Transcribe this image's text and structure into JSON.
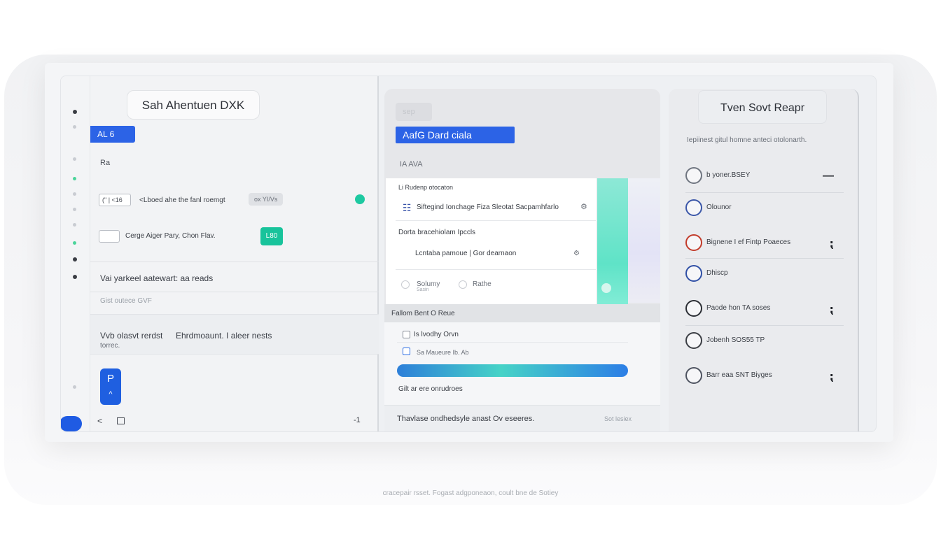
{
  "panel_left": {
    "title": "Sah Ahentuen DXK",
    "tag": "AL 6",
    "small_label": "Ra",
    "row1": {
      "chip": "(\" | <16",
      "text": "<Lboed ahe the fanl roemgt",
      "pill": "ox YI/Vs"
    },
    "row2": {
      "chip": "",
      "text": "Cerge Aiger Pary, Chon Flav.",
      "button": "L80"
    },
    "section1_title": "Vai yarkeel aatewart: aa reads",
    "section1_sub": "Gist outece GVF",
    "section2_left": "Vvb olasvt rerdst",
    "section2_right": "Ehrdmoaunt. I aleer nests",
    "section2_sub": "torrec.",
    "blue_button_icon": "P",
    "blue_button_caret": "^",
    "back_icon": "<",
    "page_counter": "-1"
  },
  "panel_middle": {
    "faint_tab": "sep",
    "tag": "AafG Dard ciala",
    "label": "IA AVA",
    "card_header": "Li Rudenp otocaton",
    "item1": "Siftegind Ionchage Fiza  Sleotat  Sacpamhfarlo",
    "item2": "Dorta bracehiolam Ipccls",
    "item3": "Lcntaba pamoue | Gor dearnaon",
    "item4_left": "Solumy",
    "item4_left_sub": "Sasin",
    "item4_right": "Rathe",
    "strip": "Fallom  Bent O Reue",
    "check1": "Is lvodhy Orvn",
    "check2": "Sa Maueure Ib. Ab",
    "lower_text": "Gilt ar ere onrudroes",
    "bottom_left": "Thavlase ondhedsyle anast  Ov eseeres.",
    "bottom_right": "Sot lesiex"
  },
  "panel_right": {
    "title": "Tven Sovt Reapr",
    "description": "Iepiinest gitul homne anteci  otolonarth.",
    "items": [
      {
        "label": "b yoner.BSEY",
        "mark": "—",
        "color": "#5d626c"
      },
      {
        "label": "Olounor",
        "mark": "",
        "color": "#3a56a8"
      },
      {
        "label": "Bignene I ef Fintp Poaeces",
        "mark": "⁏",
        "color": "#c23b2a"
      },
      {
        "label": "Dhiscp",
        "mark": "",
        "color": "#2f4fa5"
      },
      {
        "label": "Paode hon TA soses",
        "mark": "⁏",
        "color": "#2b2e34"
      },
      {
        "label": "Jobenh SOS55 TP",
        "mark": "",
        "color": "#3b3e44"
      },
      {
        "label": "Barr eaa SNT Biyges",
        "mark": "⁏",
        "color": "#4e5360"
      }
    ]
  },
  "caption": "cracepair rsset. Fogast adgponeaon, coult bne de Sotiey"
}
